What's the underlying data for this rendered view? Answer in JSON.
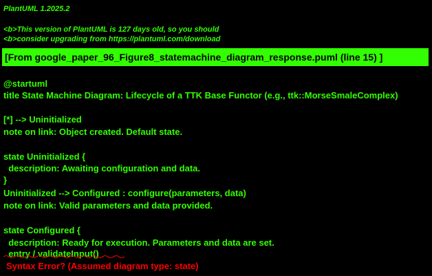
{
  "app": {
    "version_title": "PlantUML 1.2025.2"
  },
  "upgrade_notice": {
    "line1": "<b>This version of PlantUML is 127 days old, so you should",
    "line2": "<b>consider upgrading from https://plantuml.com/download"
  },
  "source_banner": {
    "text": "[From google_paper_96_Figure8_statemachine_diagram_response.puml (line 15) ]"
  },
  "code_lines": [
    "@startuml",
    "title State Machine Diagram: Lifecycle of a TTK Base Functor (e.g., ttk::MorseSmaleComplex)",
    "",
    "[*] --> Uninitialized",
    "note on link: Object created. Default state.",
    "",
    "state Uninitialized {",
    "  description: Awaiting configuration and data.",
    "}",
    "Uninitialized --> Configured : configure(parameters, data)",
    "note on link: Valid parameters and data provided.",
    "",
    "state Configured {",
    "  description: Ready for execution. Parameters and data are set.",
    "  entry / validateInput()"
  ],
  "error": {
    "message": "Syntax Error? (Assumed diagram type: state)"
  },
  "colors": {
    "background": "#000000",
    "text": "#33FF02",
    "banner": "#33FF02",
    "error": "#FF0000"
  }
}
